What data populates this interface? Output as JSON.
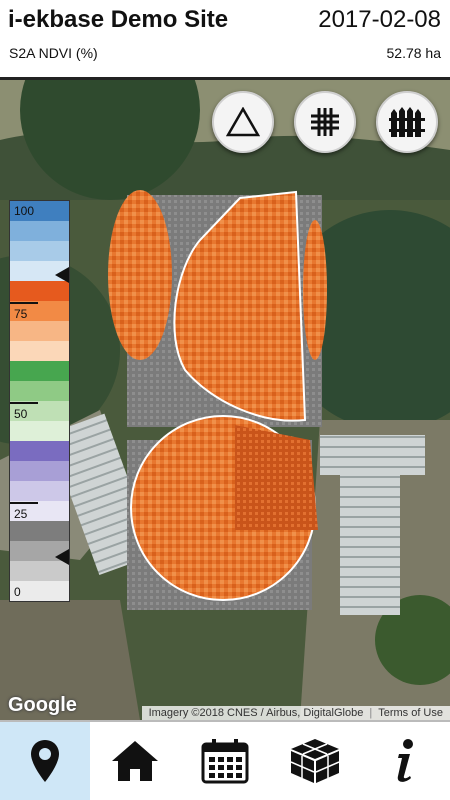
{
  "header": {
    "site_title": "i-ekbase Demo Site",
    "date": "2017-02-08",
    "layer": "S2A NDVI (%)",
    "area": "52.78 ha"
  },
  "map_buttons": [
    {
      "icon": "triangle-icon"
    },
    {
      "icon": "grid-icon"
    },
    {
      "icon": "fence-icon"
    }
  ],
  "legend": {
    "labels": [
      "100",
      "75",
      "50",
      "25",
      "0"
    ],
    "colors": {
      "blue": "#3b82c4",
      "orange": "#f07a30",
      "green": "#4caf50",
      "purple": "#7b6bbf",
      "gray": "#808080"
    }
  },
  "attribution": {
    "google": "Google",
    "imagery": "Imagery ©2018 CNES / Airbus, DigitalGlobe",
    "terms": "Terms of Use"
  },
  "nav": [
    {
      "icon": "map-pin-icon",
      "active": true
    },
    {
      "icon": "home-icon",
      "active": false
    },
    {
      "icon": "calendar-icon",
      "active": false
    },
    {
      "icon": "cube-icon",
      "active": false
    },
    {
      "icon": "info-icon",
      "active": false
    }
  ]
}
